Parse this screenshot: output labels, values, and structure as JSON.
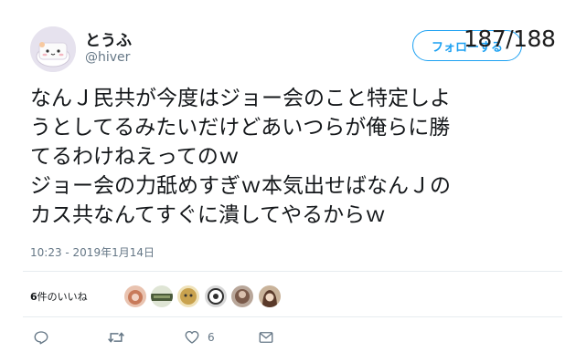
{
  "user": {
    "display_name": "とうふ",
    "handle": "@hiver",
    "avatar_icon": "tofu-avatar"
  },
  "follow_button": {
    "label": "フォローする"
  },
  "page_counter": "187/188",
  "tweet": {
    "lines": [
      "なんＪ民共が今度はジョー会のこと特定しよ",
      "うとしてるみたいだけどあいつらが俺らに勝",
      "てるわけねえってのｗ",
      "ジョー会の力舐めすぎｗ本気出せばなんＪの",
      "カス共なんてすぐに潰してやるからｗ"
    ],
    "timestamp": "10:23 - 2019年1月14日"
  },
  "likes": {
    "count": "6",
    "label": "件のいいね"
  },
  "likers": [
    {
      "icon": "liker-avatar-1",
      "color": "#c87a5a"
    },
    {
      "icon": "liker-avatar-2",
      "color": "#4a5a3a"
    },
    {
      "icon": "liker-avatar-3",
      "color": "#c9a24e"
    },
    {
      "icon": "liker-avatar-4",
      "color": "#2f2f2f"
    },
    {
      "icon": "liker-avatar-5",
      "color": "#7a5a4a"
    },
    {
      "icon": "liker-avatar-6",
      "color": "#5a3a2a"
    }
  ],
  "actions": {
    "reply_icon": "reply-icon",
    "retweet_icon": "retweet-icon",
    "like_icon": "heart-icon",
    "like_count": "6",
    "dm_icon": "envelope-icon"
  },
  "colors": {
    "accent": "#1da1f2",
    "secondary_text": "#657786",
    "divider": "#e6ecf0"
  }
}
